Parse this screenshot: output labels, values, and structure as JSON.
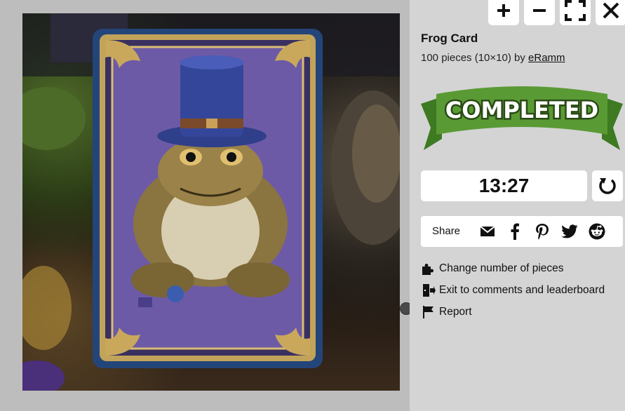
{
  "puzzle": {
    "title": "Frog Card",
    "pieces_text": "100 pieces (10×10) by ",
    "author": "eRamm",
    "banner_text": "COMPLETED",
    "timer": "13:27"
  },
  "share": {
    "label": "Share",
    "icons": [
      "email-icon",
      "facebook-icon",
      "pinterest-icon",
      "twitter-icon",
      "reddit-icon"
    ]
  },
  "actions": [
    {
      "label": "Change number of pieces",
      "icon": "puzzle-piece-icon"
    },
    {
      "label": "Exit to comments and leaderboard",
      "icon": "exit-door-icon"
    },
    {
      "label": "Report",
      "icon": "flag-icon"
    }
  ],
  "toolbar": {
    "icons": [
      "zoom-in-icon",
      "zoom-out-icon",
      "fullscreen-icon",
      "close-icon"
    ]
  },
  "colors": {
    "banner_green": "#5a9a34",
    "banner_dark": "#3d7a22",
    "card_blue": "#23457a",
    "card_purple": "#6d5aa6",
    "gold": "#b8944a"
  }
}
